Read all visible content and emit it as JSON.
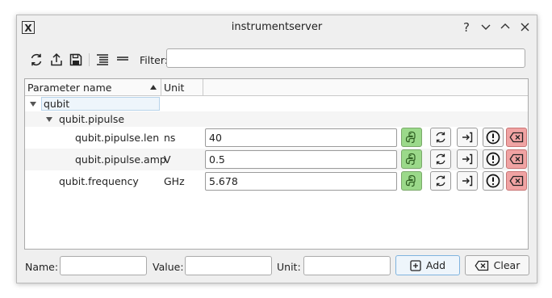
{
  "window": {
    "title": "instrumentserver",
    "controls": [
      "?",
      "⌄",
      "⌃",
      "✕"
    ]
  },
  "toolbar": {
    "filter_label": "Filter:",
    "filter_value": ""
  },
  "tree": {
    "headers": [
      "Parameter name",
      "Unit"
    ],
    "rows": [
      {
        "name": "qubit",
        "unit": "",
        "value": null
      },
      {
        "name": "qubit.pipulse",
        "unit": "",
        "value": null
      },
      {
        "name": "qubit.pipulse.len",
        "unit": "ns",
        "value": "40"
      },
      {
        "name": "qubit.pipulse.amp",
        "unit": "V",
        "value": "0.5"
      },
      {
        "name": "qubit.frequency",
        "unit": "GHz",
        "value": "5.678"
      }
    ]
  },
  "bottom": {
    "name_label": "Name:",
    "value_label": "Value:",
    "unit_label": "Unit:",
    "add_label": "Add",
    "clear_label": "Clear"
  },
  "colors": {
    "python_button": "#9bd98a",
    "delete_button": "#f0a3a3"
  }
}
